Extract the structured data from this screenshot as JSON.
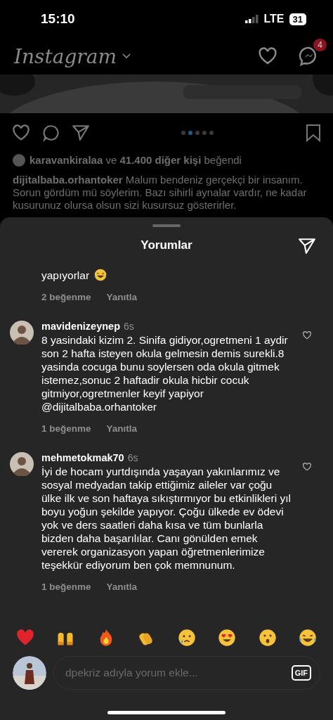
{
  "status_bar": {
    "time": "15:10",
    "network": "LTE",
    "battery": "31"
  },
  "header": {
    "logo": "Instagram",
    "messages_badge": "4"
  },
  "post": {
    "carousel": [
      {
        "selected": false
      },
      {
        "selected": true
      },
      {
        "selected": false
      },
      {
        "selected": false
      },
      {
        "selected": false
      }
    ],
    "likes": "**karavankiralaa** ve **41.400 diğer kişi** beğendi",
    "caption": "**dijitalbaba.orhantoker** Malum bendeniz gerçekçi bir insanım. Sorun gördüm mü söylerim. Bazı sihirli aynalar vardır, ne kadar kusurunuz olursa olsun sizi kusursuz gösterirler."
  },
  "comments_sheet": {
    "title": "Yorumlar",
    "comments": [
      {
        "text": "yapıyorlar",
        "emoji": {
          "kind": "laughing"
        },
        "likes": "2 beğenme",
        "reply": "Yanıtla"
      },
      {
        "user": "mavidenizeynep",
        "time": "6s",
        "text": "8 yasindaki kizim 2. Sinifa gidiyor,ogretmeni 1 aydir son 2 hafta isteyen okula gelmesin demis surekli.8 yasinda cocuga bunu soylersen oda okula gitmek istemez,sonuc 2 haftadir okula hicbir cocuk gitmiyor,ogretmenler keyif yapiyor @dijitalbaba.orhantoker",
        "likes": "1 beğenme",
        "reply": "Yanıtla",
        "liked": false
      },
      {
        "user": "mehmetokmak70",
        "time": "6s",
        "text": "İyi de hocam yurtdışında yaşayan yakınlarımız ve sosyal medyadan takip ettiğimiz aileler var çoğu ülke ilk ve son haftaya sıkıştırmıyor bu etkinlikleri yıl boyu yoğun şekilde yapıyor. Çoğu ülkede ev ödevi yok ve ders saatleri daha kısa ve tüm bunlarla bizden daha başarılılar. Canı gönülden emek vererek organizasyon yapan öğretmenlerimize teşekkür ediyorum ben çok memnunum.",
        "likes": "1 beğenme",
        "reply": "Yanıtla",
        "liked": false
      }
    ],
    "reactions": [
      {
        "kind": "heart"
      },
      {
        "kind": "raised-hands"
      },
      {
        "kind": "fire"
      },
      {
        "kind": "clap"
      },
      {
        "kind": "crying"
      },
      {
        "kind": "heart-eyes"
      },
      {
        "kind": "surprised"
      },
      {
        "kind": "laughing"
      }
    ],
    "input": {
      "placeholder": "dpekriz adıyla yorum ekle...",
      "gif": "GIF"
    }
  }
}
